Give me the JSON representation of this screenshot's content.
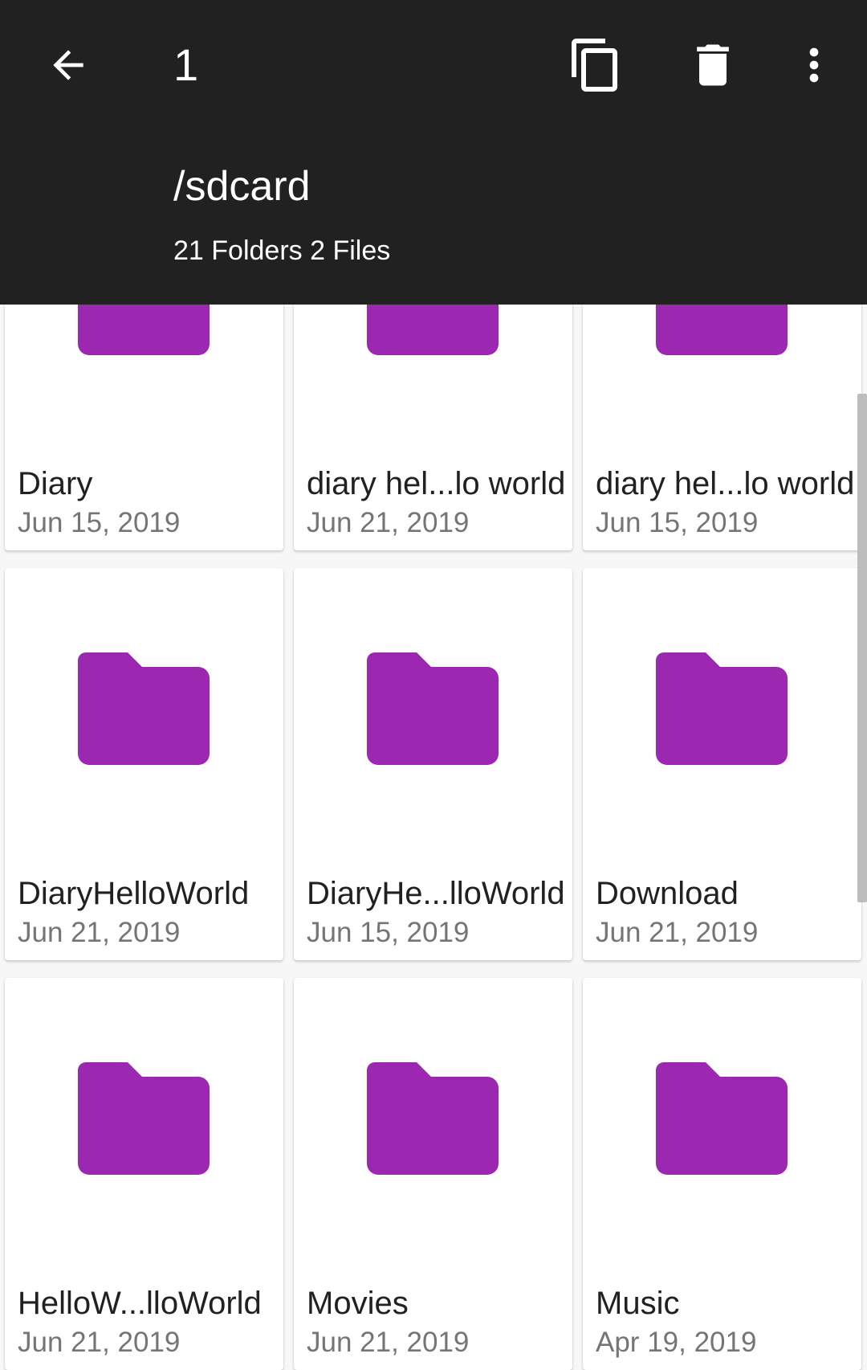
{
  "appbar": {
    "selected_count": "1",
    "path": "/sdcard",
    "summary": "21 Folders 2 Files",
    "icons": {
      "back": "arrow-back-icon",
      "copy": "copy-icon",
      "delete": "delete-icon",
      "more": "more-vert-icon"
    }
  },
  "folder_color": "#9c27b0",
  "items": [
    {
      "name": "Diary",
      "date": "Jun 15, 2019"
    },
    {
      "name": "diary hel...lo world",
      "date": "Jun 21, 2019"
    },
    {
      "name": "diary hel...lo world",
      "date": "Jun 15, 2019"
    },
    {
      "name": "DiaryHelloWorld",
      "date": "Jun 21, 2019"
    },
    {
      "name": "DiaryHe...lloWorld",
      "date": "Jun 15, 2019"
    },
    {
      "name": "Download",
      "date": "Jun 21, 2019"
    },
    {
      "name": "HelloW...lloWorld",
      "date": "Jun 21, 2019"
    },
    {
      "name": "Movies",
      "date": "Jun 21, 2019"
    },
    {
      "name": "Music",
      "date": "Apr 19, 2019"
    }
  ]
}
